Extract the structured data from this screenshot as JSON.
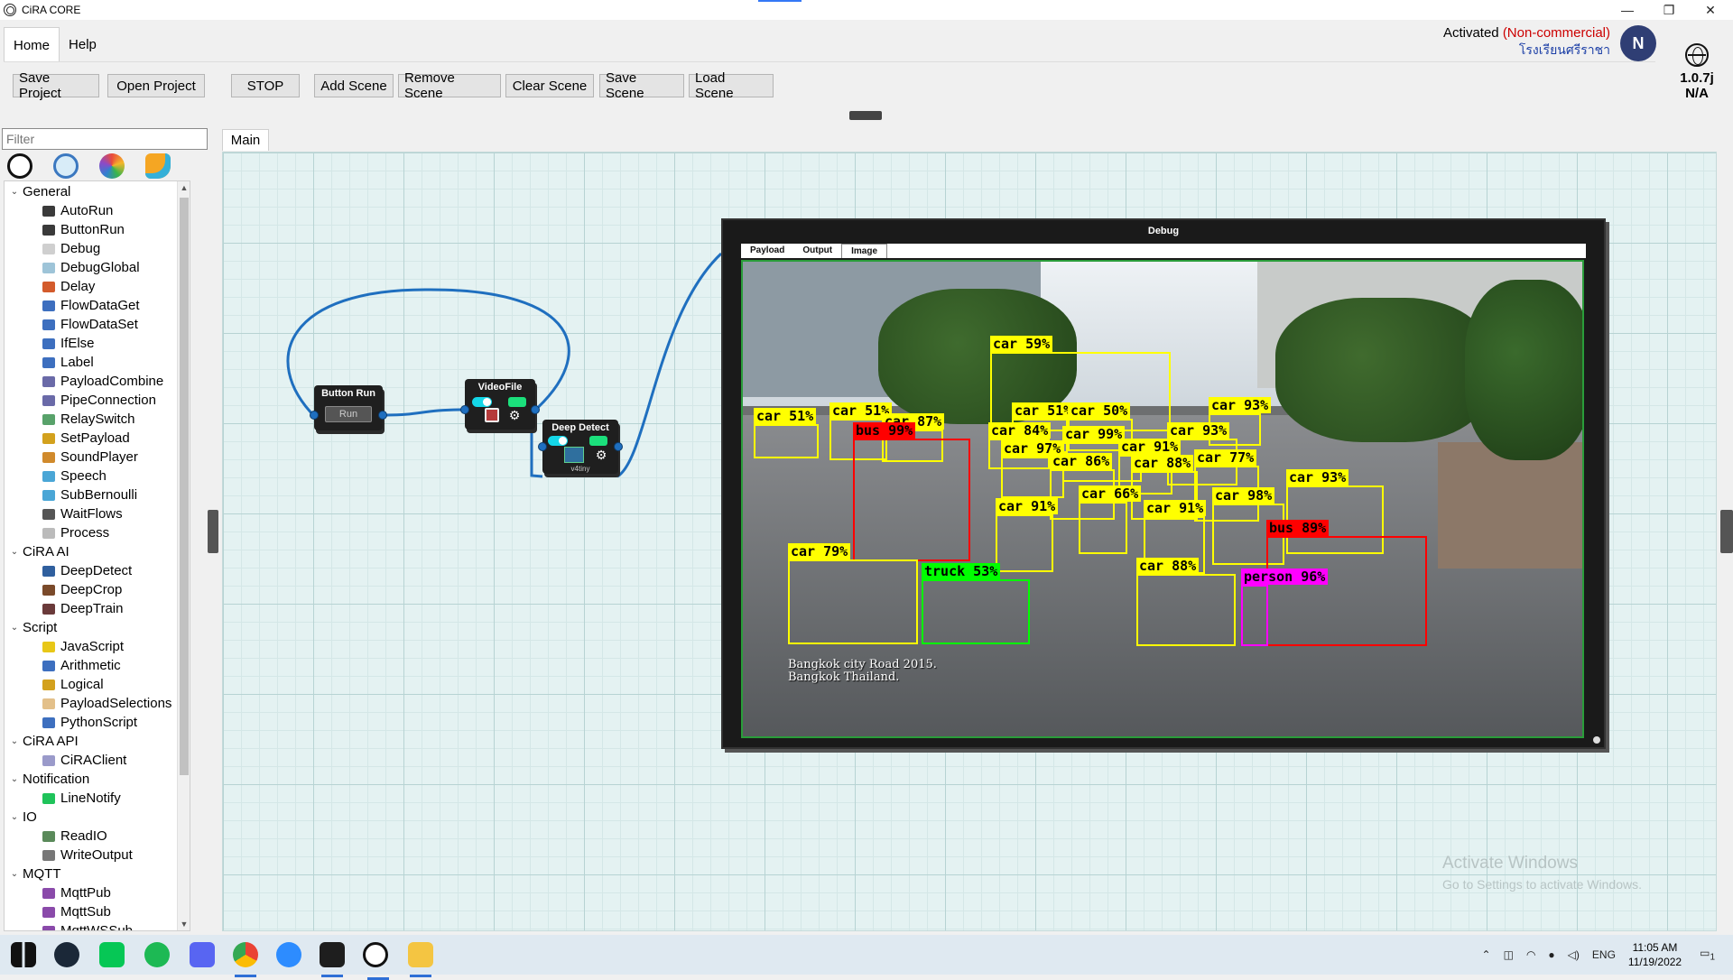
{
  "window": {
    "title": "CiRA CORE",
    "minimize_glyph": "—",
    "restore_glyph": "❐",
    "close_glyph": "✕"
  },
  "menu": {
    "tabs": [
      {
        "label": "Home"
      },
      {
        "label": "Help"
      }
    ]
  },
  "toolbar": {
    "save_project": "Save Project",
    "open_project": "Open Project",
    "stop": "STOP",
    "add_scene": "Add Scene",
    "remove_scene": "Remove Scene",
    "clear_scene": "Clear Scene",
    "save_scene": "Save Scene",
    "load_scene": "Load Scene"
  },
  "account": {
    "activated_prefix": "Activated ",
    "license_status": "(Non-commercial)",
    "organization": "โรงเรียนศรีราชา",
    "avatar_initial": "N",
    "version": "1.0.7j",
    "version_status": "N/A"
  },
  "left_panel": {
    "filter_placeholder": "Filter",
    "palette_tabs": [
      "globe-icon",
      "ai-icon",
      "wheel-icon",
      "chart-icon"
    ],
    "tree": [
      {
        "type": "category",
        "label": "General"
      },
      {
        "type": "item",
        "label": "AutoRun",
        "icon_color": "#3a3a3a"
      },
      {
        "type": "item",
        "label": "ButtonRun",
        "icon_color": "#3a3a3a"
      },
      {
        "type": "item",
        "label": "Debug",
        "icon_color": "#cfcfcf"
      },
      {
        "type": "item",
        "label": "DebugGlobal",
        "icon_color": "#9ec4d8"
      },
      {
        "type": "item",
        "label": "Delay",
        "icon_color": "#d35b2c"
      },
      {
        "type": "item",
        "label": "FlowDataGet",
        "icon_color": "#3d6fbf"
      },
      {
        "type": "item",
        "label": "FlowDataSet",
        "icon_color": "#3d6fbf"
      },
      {
        "type": "item",
        "label": "IfElse",
        "icon_color": "#3d6fbf"
      },
      {
        "type": "item",
        "label": "Label",
        "icon_color": "#3d6fbf"
      },
      {
        "type": "item",
        "label": "PayloadCombine",
        "icon_color": "#6a6aa8"
      },
      {
        "type": "item",
        "label": "PipeConnection",
        "icon_color": "#6a6aa8"
      },
      {
        "type": "item",
        "label": "RelaySwitch",
        "icon_color": "#58a26a"
      },
      {
        "type": "item",
        "label": "SetPayload",
        "icon_color": "#d3a11d"
      },
      {
        "type": "item",
        "label": "SoundPlayer",
        "icon_color": "#d08a2c"
      },
      {
        "type": "item",
        "label": "Speech",
        "icon_color": "#4aa6d6"
      },
      {
        "type": "item",
        "label": "SubBernoulli",
        "icon_color": "#4aa6d6"
      },
      {
        "type": "item",
        "label": "WaitFlows",
        "icon_color": "#555555"
      },
      {
        "type": "item",
        "label": "Process",
        "icon_color": "#bbbbbb"
      },
      {
        "type": "category",
        "label": "CiRA AI"
      },
      {
        "type": "item",
        "label": "DeepDetect",
        "icon_color": "#2f5f9e"
      },
      {
        "type": "item",
        "label": "DeepCrop",
        "icon_color": "#7a4a2a"
      },
      {
        "type": "item",
        "label": "DeepTrain",
        "icon_color": "#6a3a3a"
      },
      {
        "type": "category",
        "label": "Script"
      },
      {
        "type": "item",
        "label": "JavaScript",
        "icon_color": "#e8c717"
      },
      {
        "type": "item",
        "label": "Arithmetic",
        "icon_color": "#3d6fbf"
      },
      {
        "type": "item",
        "label": "Logical",
        "icon_color": "#d3a11d"
      },
      {
        "type": "item",
        "label": "PayloadSelections",
        "icon_color": "#e3c08a"
      },
      {
        "type": "item",
        "label": "PythonScript",
        "icon_color": "#3d6fbf"
      },
      {
        "type": "category",
        "label": "CiRA API"
      },
      {
        "type": "item",
        "label": "CiRAClient",
        "icon_color": "#9a9aca"
      },
      {
        "type": "category",
        "label": "Notification"
      },
      {
        "type": "item",
        "label": "LineNotify",
        "icon_color": "#1fc35a"
      },
      {
        "type": "category",
        "label": "IO"
      },
      {
        "type": "item",
        "label": "ReadIO",
        "icon_color": "#5a8a5a"
      },
      {
        "type": "item",
        "label": "WriteOutput",
        "icon_color": "#777777"
      },
      {
        "type": "category",
        "label": "MQTT"
      },
      {
        "type": "item",
        "label": "MqttPub",
        "icon_color": "#8a4aaa"
      },
      {
        "type": "item",
        "label": "MqttSub",
        "icon_color": "#8a4aaa"
      },
      {
        "type": "item",
        "label": "MqttWSSub",
        "icon_color": "#8a4aaa"
      }
    ]
  },
  "canvas": {
    "tab_label": "Main",
    "nodes": {
      "button_run": {
        "title": "Button Run",
        "button_label": "Run"
      },
      "video_file": {
        "title": "VideoFile"
      },
      "deep_detect": {
        "title": "Deep Detect",
        "model": "v4tiny"
      }
    },
    "debug": {
      "title": "Debug",
      "tabs": [
        "Payload",
        "Output",
        "Image"
      ],
      "active_tab": "Image",
      "caption_line1": "Bangkok city Road 2015.",
      "caption_line2": "Bangkok Thailand.",
      "detections": [
        {
          "label": "car 59%",
          "color": "#ffff00"
        },
        {
          "label": "car 51%",
          "color": "#ffff00"
        },
        {
          "label": "car 51%",
          "color": "#ffff00"
        },
        {
          "label": "car 87%",
          "color": "#ffff00"
        },
        {
          "label": "bus 99%",
          "color": "#ff0000"
        },
        {
          "label": "car 51%",
          "color": "#ffff00"
        },
        {
          "label": "car 50%",
          "color": "#ffff00"
        },
        {
          "label": "car 93%",
          "color": "#ffff00"
        },
        {
          "label": "car 84%",
          "color": "#ffff00"
        },
        {
          "label": "car 99%",
          "color": "#ffff00"
        },
        {
          "label": "car 93%",
          "color": "#ffff00"
        },
        {
          "label": "car 97%",
          "color": "#ffff00"
        },
        {
          "label": "car 91%",
          "color": "#ffff00"
        },
        {
          "label": "car 86%",
          "color": "#ffff00"
        },
        {
          "label": "car 88%",
          "color": "#ffff00"
        },
        {
          "label": "car 77%",
          "color": "#ffff00"
        },
        {
          "label": "car 66%",
          "color": "#ffff00"
        },
        {
          "label": "car 91%",
          "color": "#ffff00"
        },
        {
          "label": "car 91%",
          "color": "#ffff00"
        },
        {
          "label": "car 98%",
          "color": "#ffff00"
        },
        {
          "label": "car 93%",
          "color": "#ffff00"
        },
        {
          "label": "bus 89%",
          "color": "#ff0000"
        },
        {
          "label": "car 79%",
          "color": "#ffff00"
        },
        {
          "label": "truck 53%",
          "color": "#00ff00"
        },
        {
          "label": "car 88%",
          "color": "#ffff00"
        },
        {
          "label": "person 96%",
          "color": "#ff00ff"
        }
      ]
    }
  },
  "watermark": {
    "line1": "Activate Windows",
    "line2": "Go to Settings to activate Windows."
  },
  "taskbar": {
    "apps": [
      "windows-start-icon",
      "steam-icon",
      "line-icon",
      "spotify-icon",
      "discord-icon",
      "chrome-icon",
      "zoom-icon",
      "terminal-icon",
      "cira-core-icon",
      "file-explorer-icon"
    ],
    "language": "ENG",
    "time": "11:05 AM",
    "date": "11/19/2022",
    "notification_count": "1"
  }
}
